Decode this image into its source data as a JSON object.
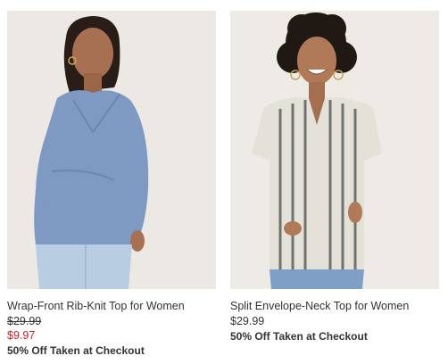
{
  "products": [
    {
      "name": "Wrap-Front Rib-Knit Top for Women",
      "original_price": "$29.99",
      "sale_price": "$9.97",
      "promo": "50% Off Taken at Checkout",
      "image_icon": "product-photo-blue-wrap-top"
    },
    {
      "name": "Split Envelope-Neck Top for Women",
      "price": "$29.99",
      "promo": "50% Off Taken at Checkout",
      "image_icon": "product-photo-striped-top"
    }
  ],
  "colors": {
    "sale_red": "#cc1f1f",
    "text": "#333333",
    "photo_bg": "#ede9e4"
  }
}
